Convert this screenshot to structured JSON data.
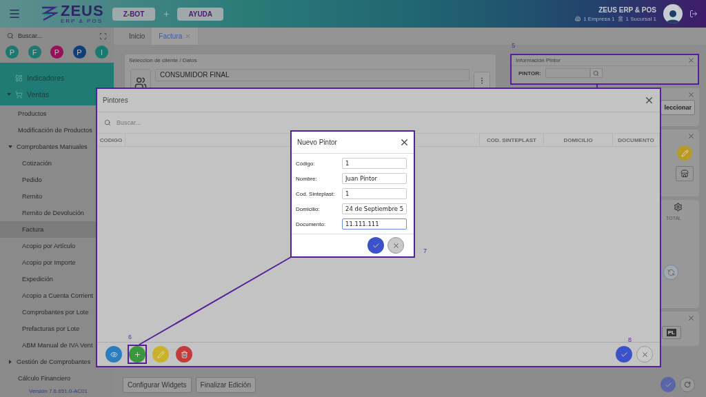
{
  "header": {
    "logo_title": "ZEUS",
    "logo_subtitle": "ERP & POS",
    "buttons": [
      {
        "label": "Z-BOT"
      },
      {
        "label": "AYUDA"
      }
    ],
    "separator": "+",
    "company": "ZEUS ERP & POS",
    "empresa": "1 Empresa 1",
    "sucursal": "1 Sucursal 1"
  },
  "sidebar": {
    "search": {
      "placeholder": "Buscar..."
    },
    "shortcuts": [
      {
        "label": "P",
        "color": "#1b7a70"
      },
      {
        "label": "F",
        "color": "#1b7a70"
      },
      {
        "label": "P",
        "color": "#9a0f5c"
      },
      {
        "label": "P",
        "color": "#123e78"
      },
      {
        "label": "I",
        "color": "#1b7a70"
      }
    ],
    "menu": [
      {
        "label": "Indicadores"
      },
      {
        "label": "Ventas",
        "expanded": true,
        "children": [
          {
            "label": "Productos",
            "selected": false
          },
          {
            "label": "Modificación de Productos",
            "selected": false
          },
          {
            "label": "Comprobantes Manuales",
            "selected": false,
            "expanded": true,
            "children": [
              {
                "label": "Cotización",
                "selected": false
              },
              {
                "label": "Pedido",
                "selected": false
              },
              {
                "label": "Remito",
                "selected": false
              },
              {
                "label": "Remito de Devolución",
                "selected": false
              },
              {
                "label": "Factura",
                "selected": true
              },
              {
                "label": "Acopio por Artículo",
                "selected": false
              },
              {
                "label": "Acopio por Importe",
                "selected": false
              },
              {
                "label": "Expedición",
                "selected": false
              },
              {
                "label": "Acopio a Cuenta Corrient",
                "selected": false
              },
              {
                "label": "Comprobantes por Lote",
                "selected": false
              },
              {
                "label": "Prefacturas por Lote",
                "selected": false
              },
              {
                "label": "ABM Manual de IVA Vent",
                "selected": false
              }
            ]
          },
          {
            "label": "Gestión de Comprobantes",
            "selected": false,
            "expanded": false
          },
          {
            "label": "Cálculo Financiero",
            "selected": false
          }
        ]
      }
    ],
    "version": "Versión 7.6.651.0-AC01"
  },
  "tabs": [
    {
      "label": "Inicio",
      "selected": false
    },
    {
      "label": "Factura",
      "selected": true
    }
  ],
  "client_panel": {
    "title": "Seleccion de cliente / Datos",
    "name": "CONSUMIDOR FINAL"
  },
  "pintor_panel": {
    "title": "Información Pintor",
    "field_label": "PINTOR:",
    "highlighted": true
  },
  "side_widgets": {
    "select_button": "leccionar",
    "total_header": "TOTAL",
    "badge": "PL"
  },
  "footer_buttons": [
    {
      "label": "Configurar Widgets"
    },
    {
      "label": "Finalizar Edición"
    }
  ],
  "pintores_modal": {
    "title": "Pintores",
    "search": {
      "placeholder": "Buscar..."
    },
    "columns": [
      {
        "label": "CODIGO"
      },
      {
        "label": "COD. SINTEPLAST"
      },
      {
        "label": "DOMICILIO"
      },
      {
        "label": "DOCUMENTO"
      }
    ],
    "actions": [
      {
        "kind": "view",
        "highlighted": false
      },
      {
        "kind": "add",
        "highlighted": true
      },
      {
        "kind": "edit",
        "highlighted": false
      },
      {
        "kind": "delete",
        "highlighted": false
      }
    ],
    "confirm": [
      {
        "kind": "accept"
      },
      {
        "kind": "cancel"
      }
    ]
  },
  "nuevo_pintor": {
    "title": "Nuevo Pintor",
    "fields": [
      {
        "label": "Código:",
        "value": "1",
        "focused": false
      },
      {
        "label": "Nombre:",
        "value": "Juan Pintor",
        "focused": false
      },
      {
        "label": "Cod. Sinteplast:",
        "value": "1",
        "focused": false
      },
      {
        "label": "Domicilio:",
        "value": "24 de Septiembre 5",
        "focused": false
      },
      {
        "label": "Documento:",
        "value": "11.111.111",
        "focused": true
      }
    ],
    "confirm": [
      {
        "kind": "accept"
      },
      {
        "kind": "cancel"
      }
    ]
  },
  "callouts": [
    {
      "number": "5"
    },
    {
      "number": "6"
    },
    {
      "number": "7"
    },
    {
      "number": "8"
    }
  ]
}
